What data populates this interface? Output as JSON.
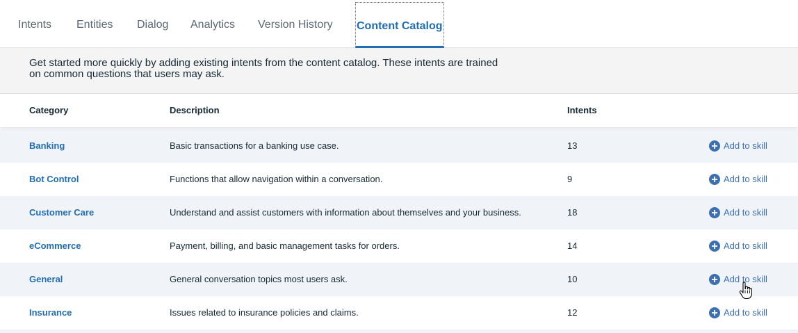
{
  "tabs": [
    {
      "label": "Intents"
    },
    {
      "label": "Entities"
    },
    {
      "label": "Dialog"
    },
    {
      "label": "Analytics"
    },
    {
      "label": "Version History"
    },
    {
      "label": "Content Catalog"
    }
  ],
  "banner": {
    "text": "Get started more quickly by adding existing intents from the content catalog. These intents are trained on common questions that users may ask."
  },
  "table": {
    "headers": {
      "category": "Category",
      "description": "Description",
      "intents": "Intents"
    },
    "rows": [
      {
        "category": "Banking",
        "description": "Basic transactions for a banking use case.",
        "intents": "13",
        "action": "Add to skill"
      },
      {
        "category": "Bot Control",
        "description": "Functions that allow navigation within a conversation.",
        "intents": "9",
        "action": "Add to skill"
      },
      {
        "category": "Customer Care",
        "description": "Understand and assist customers with information about themselves and your business.",
        "intents": "18",
        "action": "Add to skill"
      },
      {
        "category": "eCommerce",
        "description": "Payment, billing, and basic management tasks for orders.",
        "intents": "14",
        "action": "Add to skill"
      },
      {
        "category": "General",
        "description": "General conversation topics most users ask.",
        "intents": "10",
        "action": "Add to skill"
      },
      {
        "category": "Insurance",
        "description": "Issues related to insurance policies and claims.",
        "intents": "12",
        "action": "Add to skill"
      }
    ]
  },
  "colors": {
    "accent": "#1f6db5",
    "link": "#3d70b2",
    "row_alt": "#f0f4f8",
    "banner_bg": "#f4f4f4"
  },
  "icons": {
    "add": "plus-circle-icon",
    "cursor": "hand-pointer-icon"
  }
}
